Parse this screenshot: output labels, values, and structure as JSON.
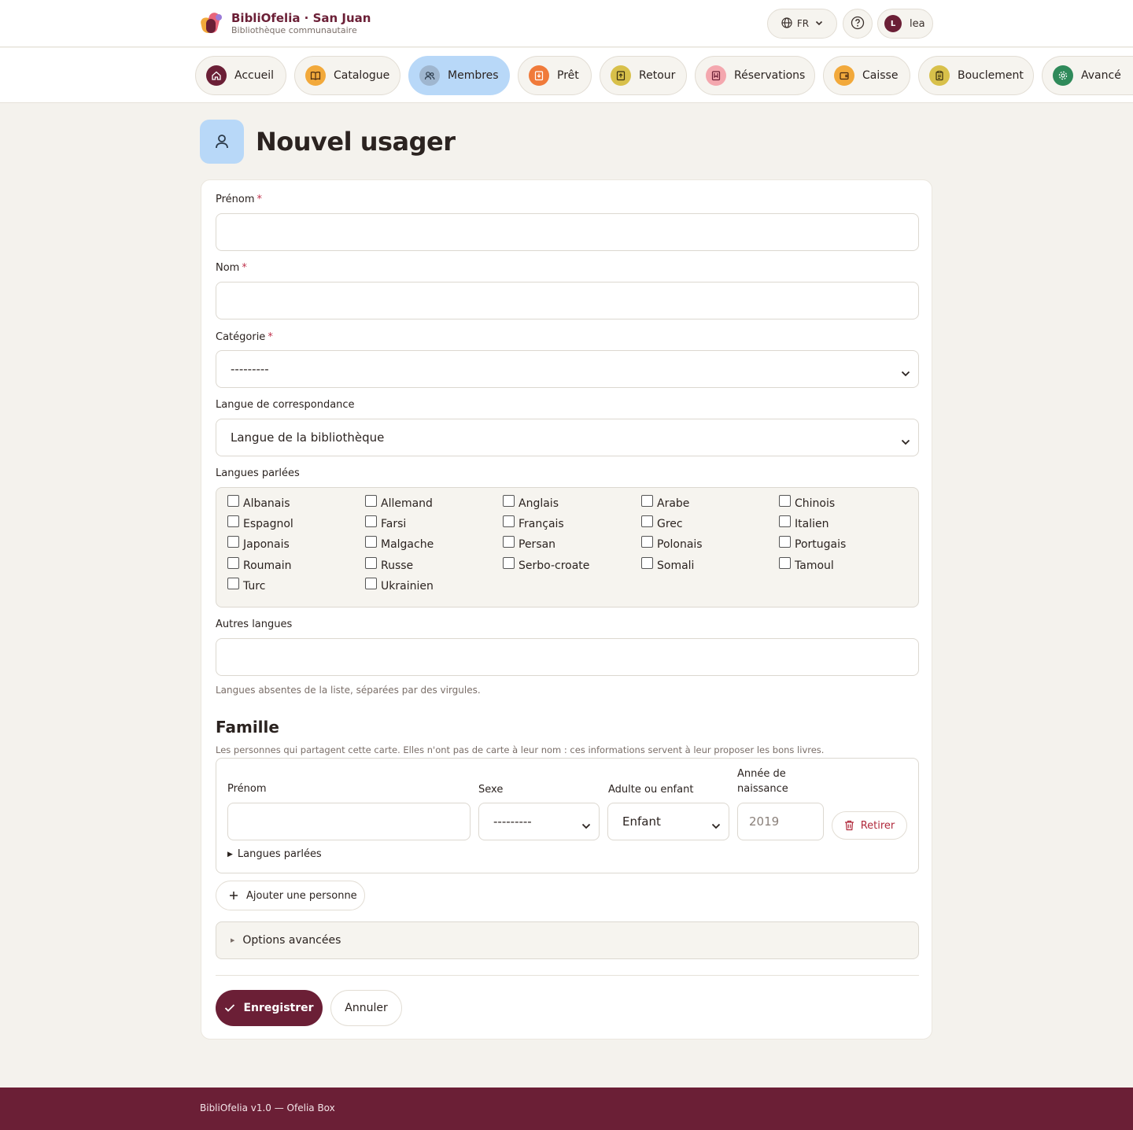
{
  "header": {
    "brand_title": "BibliOfelia · San Juan",
    "brand_subtitle": "Bibliothèque communautaire",
    "language": "FR",
    "user_initial": "L",
    "user_name": "lea"
  },
  "nav": [
    {
      "label": "Accueil",
      "icon": "home-icon",
      "color": "#6b1f36"
    },
    {
      "label": "Catalogue",
      "icon": "book-icon",
      "color": "#f2a93b"
    },
    {
      "label": "Membres",
      "icon": "users-icon",
      "color": "#9fb6cf"
    },
    {
      "label": "Prêt",
      "icon": "loan-icon",
      "color": "#f07a3a"
    },
    {
      "label": "Retour",
      "icon": "return-icon",
      "color": "#d8c04a"
    },
    {
      "label": "Réservations",
      "icon": "bookmark-icon",
      "color": "#f4a7ae"
    },
    {
      "label": "Caisse",
      "icon": "wallet-icon",
      "color": "#f2a93b"
    },
    {
      "label": "Bouclement",
      "icon": "clipboard-icon",
      "color": "#d8c04a"
    },
    {
      "label": "Avancé",
      "icon": "gear-icon",
      "color": "#2f8a5a"
    }
  ],
  "page": {
    "title": "Nouvel usager"
  },
  "form": {
    "first_name_label": "Prénom",
    "last_name_label": "Nom",
    "category_label": "Catégorie",
    "category_value": "---------",
    "corr_lang_label": "Langue de correspondance",
    "corr_lang_value": "Langue de la bibliothèque",
    "spoken_label": "Langues parlées",
    "languages": [
      "Albanais",
      "Allemand",
      "Anglais",
      "Arabe",
      "Chinois",
      "Espagnol",
      "Farsi",
      "Français",
      "Grec",
      "Italien",
      "Japonais",
      "Malgache",
      "Persan",
      "Polonais",
      "Portugais",
      "Roumain",
      "Russe",
      "Serbo-croate",
      "Somali",
      "Tamoul",
      "Turc",
      "Ukrainien"
    ],
    "other_lang_label": "Autres langues",
    "other_lang_hint": "Langues absentes de la liste, séparées par des virgules.",
    "required_mark": "*"
  },
  "family": {
    "title": "Famille",
    "description": "Les personnes qui partagent cette carte. Elles n'ont pas de carte à leur nom : ces informations servent à leur proposer les bons livres.",
    "col_first_name": "Prénom",
    "col_sex": "Sexe",
    "col_age": "Adulte ou enfant",
    "col_year_1": "Année de",
    "col_year_2": "naissance",
    "sex_value": "---------",
    "age_value": "Enfant",
    "year_placeholder": "2019",
    "remove_label": "Retirer",
    "langs_toggle": "Langues parlées",
    "add_label": "Ajouter une personne"
  },
  "advanced": {
    "label": "Options avancées"
  },
  "actions": {
    "save": "Enregistrer",
    "cancel": "Annuler"
  },
  "footer": {
    "text": "BibliOfelia v1.0 — Ofelia Box"
  }
}
